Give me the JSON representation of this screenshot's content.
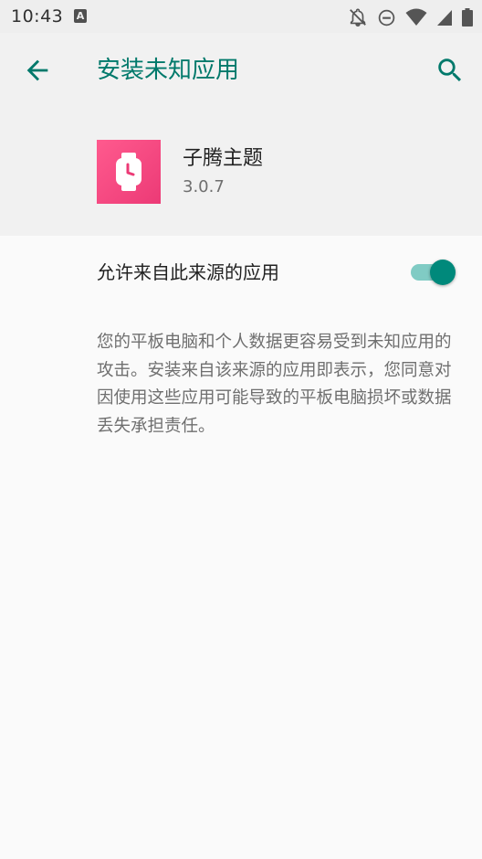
{
  "status_bar": {
    "time": "10:43",
    "notification_icon": "A",
    "icons": [
      "notifications-off-icon",
      "do-not-disturb-icon",
      "wifi-icon",
      "cellular-signal-icon",
      "battery-icon"
    ]
  },
  "toolbar": {
    "title": "安装未知应用",
    "back_icon": "arrow-back-icon",
    "search_icon": "search-icon"
  },
  "app": {
    "name": "子腾主题",
    "version": "3.0.7",
    "icon": "watch-icon"
  },
  "setting": {
    "label": "允许来自此来源的应用",
    "enabled": true
  },
  "description": "您的平板电脑和个人数据更容易受到未知应用的攻击。安装来自该来源的应用即表示，您同意对因使用这些应用可能导致的平板电脑损坏或数据丢失承担责任。",
  "colors": {
    "accent": "#00796b",
    "switch_thumb": "#00897b",
    "switch_track": "#80cbc4",
    "app_icon_bg": "#f23e7c"
  }
}
